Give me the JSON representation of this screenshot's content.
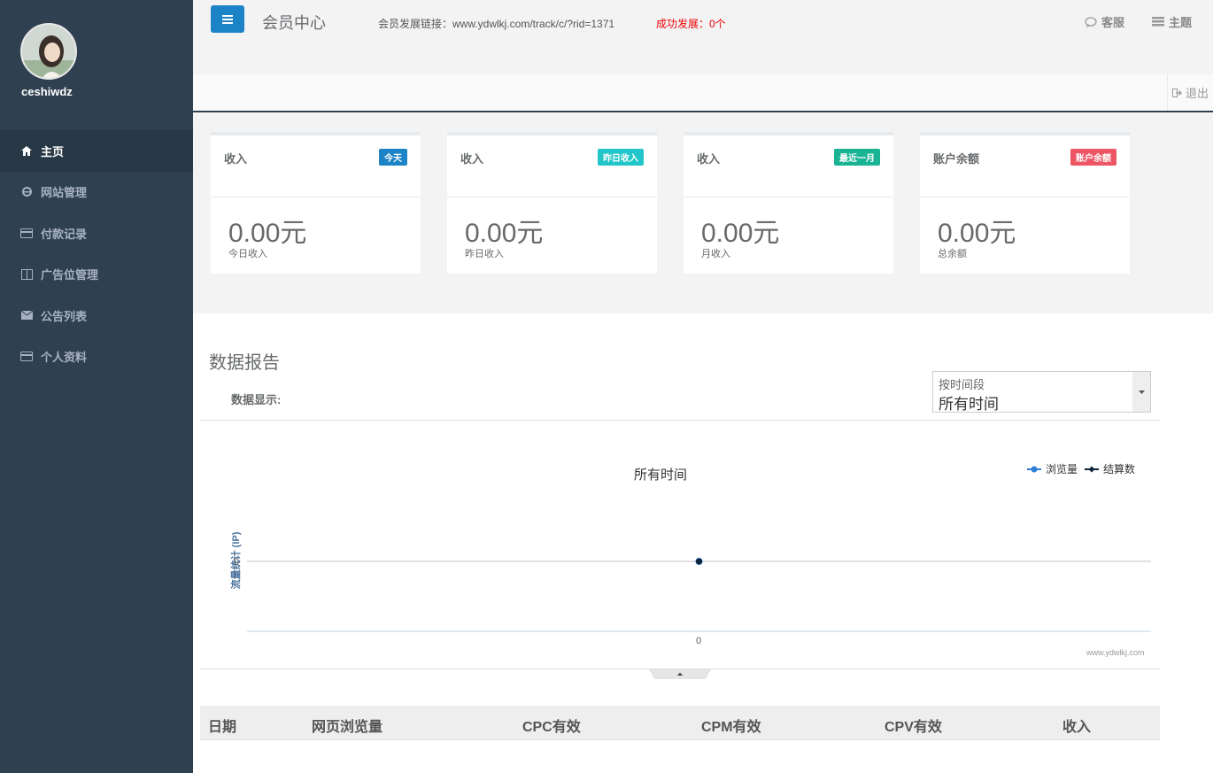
{
  "sidebar": {
    "username": "ceshiwdz",
    "items": [
      {
        "label": "主页",
        "icon": "home-icon"
      },
      {
        "label": "网站管理",
        "icon": "ie-icon"
      },
      {
        "label": "付款记录",
        "icon": "credit-card-icon"
      },
      {
        "label": "广告位管理",
        "icon": "columns-icon"
      },
      {
        "label": "公告列表",
        "icon": "envelope-icon"
      },
      {
        "label": "个人资料",
        "icon": "id-card-icon"
      }
    ]
  },
  "header": {
    "title": "会员中心",
    "link_label": "会员发展链接：www.ydwlkj.com/track/c/?rid=1371",
    "success_label": "成功发展：0个",
    "service_label": "客服",
    "theme_label": "主题",
    "logout_label": "退出"
  },
  "cards": [
    {
      "title": "收入",
      "badge": "今天",
      "badge_color": "#1c84c6",
      "value": "0.00元",
      "sub": "今日收入"
    },
    {
      "title": "收入",
      "badge": "昨日收入",
      "badge_color": "#23c6c8",
      "value": "0.00元",
      "sub": "昨日收入"
    },
    {
      "title": "收入",
      "badge": "最近一月",
      "badge_color": "#1ab394",
      "value": "0.00元",
      "sub": "月收入"
    },
    {
      "title": "账户余额",
      "badge": "账户余额",
      "badge_color": "#ed5565",
      "value": "0.00元",
      "sub": "总余额"
    }
  ],
  "report": {
    "title": "数据报告",
    "data_show_label": "数据显示:",
    "select_label": "按时间段",
    "select_value": "所有时间"
  },
  "chart_data": {
    "type": "line",
    "title": "所有时间",
    "ylabel": "流量统计 (IP)",
    "x": [
      0
    ],
    "series": [
      {
        "name": "浏览量",
        "values": [
          0
        ],
        "color": "#2f7ed8"
      },
      {
        "name": "结算数",
        "values": [
          0
        ],
        "color": "#0d233a"
      }
    ],
    "y_tick": "0",
    "x_tick": "0",
    "credit": "www.ydwlkj.com",
    "legend": "top-right"
  },
  "table": {
    "headers": [
      "日期",
      "网页浏览量",
      "CPC有效",
      "CPM有效",
      "CPV有效",
      "收入"
    ]
  }
}
